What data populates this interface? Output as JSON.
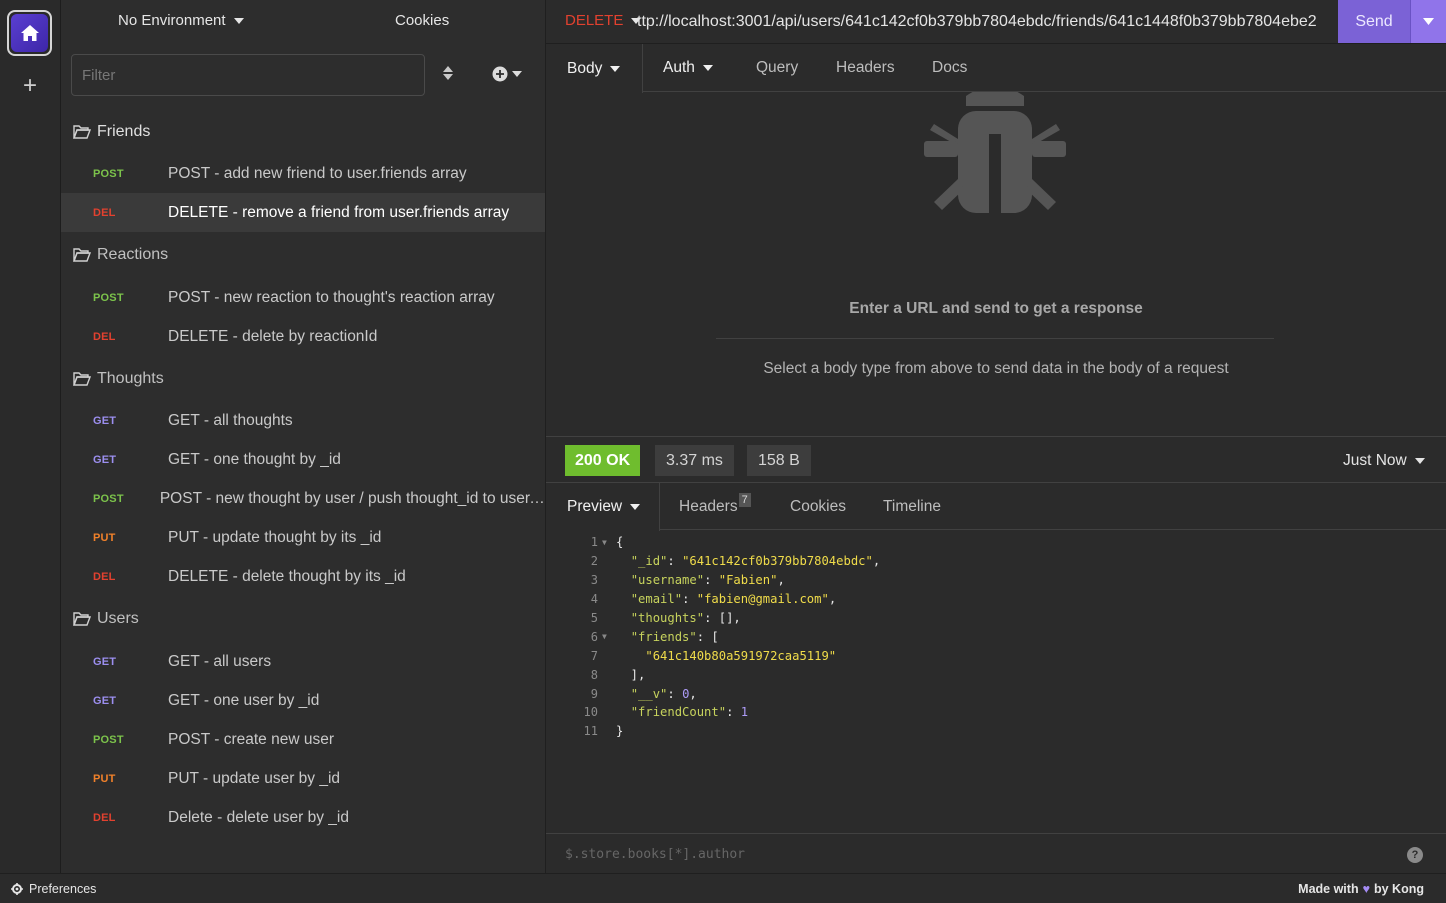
{
  "sidebar": {
    "environment": "No Environment",
    "cookies": "Cookies",
    "filter_placeholder": "Filter",
    "folders": [
      {
        "name": "Friends",
        "requests": [
          {
            "method": "POST",
            "name": "POST - add new friend to user.friends array"
          },
          {
            "method": "DEL",
            "name": "DELETE - remove a friend from user.friends array",
            "active": true
          }
        ]
      },
      {
        "name": "Reactions",
        "requests": [
          {
            "method": "POST",
            "name": "POST - new reaction to thought's reaction array"
          },
          {
            "method": "DEL",
            "name": "DELETE - delete by reactionId"
          }
        ]
      },
      {
        "name": "Thoughts",
        "requests": [
          {
            "method": "GET",
            "name": "GET - all thoughts"
          },
          {
            "method": "GET",
            "name": "GET - one thought by _id"
          },
          {
            "method": "POST",
            "name": "POST - new thought by user / push thought_id to user.thoughts array"
          },
          {
            "method": "PUT",
            "name": "PUT - update thought by its _id"
          },
          {
            "method": "DEL",
            "name": "DELETE - delete thought by its _id"
          }
        ]
      },
      {
        "name": "Users",
        "requests": [
          {
            "method": "GET",
            "name": "GET - all users"
          },
          {
            "method": "GET",
            "name": "GET - one user by _id"
          },
          {
            "method": "POST",
            "name": "POST - create new user"
          },
          {
            "method": "PUT",
            "name": "PUT - update user by _id"
          },
          {
            "method": "DEL",
            "name": "Delete - delete user by _id"
          }
        ]
      }
    ]
  },
  "request": {
    "method": "DELETE",
    "url": "ttp://localhost:3001/api/users/641c142cf0b379bb7804ebdc/friends/641c1448f0b379bb7804ebe2",
    "send_label": "Send",
    "tabs": {
      "body": "Body",
      "auth": "Auth",
      "query": "Query",
      "headers": "Headers",
      "docs": "Docs"
    },
    "empty_title": "Enter a URL and send to get a response",
    "empty_hint": "Select a body type from above to send data in the body of a request"
  },
  "response": {
    "status": "200 OK",
    "time": "3.37 ms",
    "size": "158 B",
    "history": "Just Now",
    "tabs": {
      "preview": "Preview",
      "headers": "Headers",
      "headers_count": "7",
      "cookies": "Cookies",
      "timeline": "Timeline"
    },
    "code_lines": [
      {
        "n": "1",
        "fold": true,
        "parts": [
          [
            "p",
            "{"
          ]
        ]
      },
      {
        "n": "2",
        "parts": [
          [
            "p",
            "  "
          ],
          [
            "k",
            "\"_id\""
          ],
          [
            "p",
            ": "
          ],
          [
            "s",
            "\"641c142cf0b379bb7804ebdc\""
          ],
          [
            "p",
            ","
          ]
        ]
      },
      {
        "n": "3",
        "parts": [
          [
            "p",
            "  "
          ],
          [
            "k",
            "\"username\""
          ],
          [
            "p",
            ": "
          ],
          [
            "s",
            "\"Fabien\""
          ],
          [
            "p",
            ","
          ]
        ]
      },
      {
        "n": "4",
        "parts": [
          [
            "p",
            "  "
          ],
          [
            "k",
            "\"email\""
          ],
          [
            "p",
            ": "
          ],
          [
            "s",
            "\"fabien@gmail.com\""
          ],
          [
            "p",
            ","
          ]
        ]
      },
      {
        "n": "5",
        "parts": [
          [
            "p",
            "  "
          ],
          [
            "k",
            "\"thoughts\""
          ],
          [
            "p",
            ": [],"
          ]
        ]
      },
      {
        "n": "6",
        "fold": true,
        "parts": [
          [
            "p",
            "  "
          ],
          [
            "k",
            "\"friends\""
          ],
          [
            "p",
            ": ["
          ]
        ]
      },
      {
        "n": "7",
        "parts": [
          [
            "p",
            "    "
          ],
          [
            "s",
            "\"641c140b80a591972caa5119\""
          ]
        ]
      },
      {
        "n": "8",
        "parts": [
          [
            "p",
            "  ],"
          ]
        ]
      },
      {
        "n": "9",
        "parts": [
          [
            "p",
            "  "
          ],
          [
            "k",
            "\"__v\""
          ],
          [
            "p",
            ": "
          ],
          [
            "n",
            "0"
          ],
          [
            "p",
            ","
          ]
        ]
      },
      {
        "n": "10",
        "parts": [
          [
            "p",
            "  "
          ],
          [
            "k",
            "\"friendCount\""
          ],
          [
            "p",
            ": "
          ],
          [
            "n",
            "1"
          ]
        ]
      },
      {
        "n": "11",
        "parts": [
          [
            "p",
            "}"
          ]
        ]
      }
    ],
    "filter_placeholder": "$.store.books[*].author",
    "help": "?"
  },
  "statusbar": {
    "preferences": "Preferences",
    "made_with": "Made with",
    "by": "by Kong"
  },
  "colors": {
    "accent": "#7b62d6",
    "post": "#7cc34b",
    "delete": "#e2412f",
    "get": "#9c8ff0",
    "put": "#f1812a",
    "ok": "#6fbd2e"
  }
}
